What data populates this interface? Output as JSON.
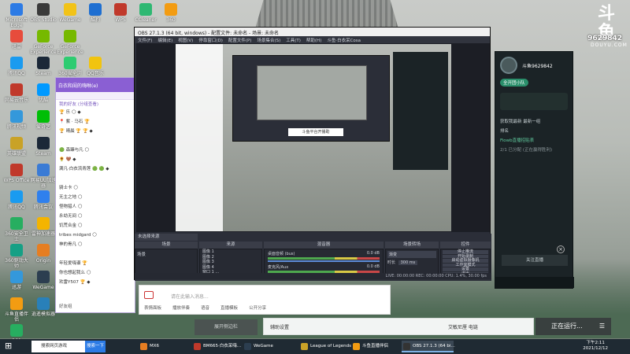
{
  "desktop": {
    "icons": [
      "Microsoft Edge",
      "OBS Studio",
      "WeGame",
      "酷狗",
      "WPS",
      "CCleaner",
      "360",
      "迅雷",
      "GeForce Experience",
      "GeForce Experience",
      "腾讯QQ",
      "Steam",
      "360安全浏览器",
      "QQ音乐",
      "网易云音乐",
      "优酷",
      "腾讯视频",
      "爱奇艺",
      "英雄联盟",
      "Steam",
      "WPS Office",
      "网易UU加速器",
      "腾讯QQ",
      "腾讯会议",
      "360安全卫士",
      "雷神加速器",
      "360驱动大师",
      "Origin",
      "迅游",
      "WeGame",
      "斗鱼直播伴侣",
      "逍遥模拟器",
      "360"
    ]
  },
  "douyu": {
    "logo_text": "斗鱼",
    "logo_sub": "DOUYU.COM",
    "room_id": "9629842",
    "panel": {
      "username": "斗鱼9629842",
      "team_label": "全开团小队",
      "recent_label": "获取我最新 最新一组",
      "rank_label": "排名",
      "rank_sub": "2/1 已分配 (正在赢得胜利)",
      "promo": "Fiowb直播招贴表",
      "close_label": "关注直播"
    },
    "helper": {
      "assist": "辅助设置",
      "music": "艾敏尼厘 电链",
      "running": "正在运行...",
      "sidebar_btn": "展开侧边栏"
    }
  },
  "chat": {
    "title": "白衣和闺的嗨咻(e)",
    "list_header": "我的好友 (分组查看)",
    "items": [
      "🏆 乐 🌕 ◆",
      "📍 紫 · 马石 🏆",
      "🏆 晴晨 🏆 🏆 ◆",
      "",
      "🟢 森臻与凡 🌕",
      "🌻 🤎 ◆",
      "满凡·白衣流青莲 🟢 🟢 ◆",
      "",
      "骑士卡 🌕",
      "无主之地 🌕",
      "怪物猎人 🌕",
      "永劫无间 🌕",
      "饥荒合金 🌕",
      "tribes midgard 🌕",
      "神的骨凡 🌕",
      "",
      "年轻爱嗨谱 🏆",
      "你也想起我么 🌕",
      "欢雷Y507 🏆 ◆"
    ],
    "footer": "好友组",
    "input_placeholder": "请在此输入消息...",
    "input_actions": [
      "表情面板",
      "播放伴奏",
      "语音",
      "直播模板",
      "公开分享"
    ]
  },
  "obs": {
    "title": "OBS 27.1.3 (64 bit, windows) - 配置文件: 未命名 - 场景: 未命名",
    "menu": [
      "文件(F)",
      "编辑(E)",
      "视图(V)",
      "停靠窗口(D)",
      "配置文件(P)",
      "场景集合(S)",
      "工具(T)",
      "帮助(H)",
      "斗鱼·白衣呆Cosa"
    ],
    "nested_caption": "斗鱼平台开播助",
    "docks": {
      "scene_label": "未选择来源",
      "scenes_header": "场景",
      "scene_item": "场景",
      "sources_header": "来源",
      "sources": [
        "图像 1",
        "图像 2",
        "图像 3",
        "图像 4",
        "窗口 1 ..."
      ],
      "mixer_header": "混音器",
      "mixer": [
        {
          "name": "桌面音频 (bus)",
          "db": "0.0 dB"
        },
        {
          "name": "麦克风/Aux",
          "db": "0.0 dB"
        }
      ],
      "transition_header": "场景转场",
      "transition_type": "渐变",
      "duration_label": "时长",
      "duration": "300 ms",
      "controls_header": "控件",
      "controls": [
        "停止推流",
        "开始录制",
        "启动虚拟摄像机",
        "工作室模式",
        "设置",
        "退出"
      ]
    },
    "status": "LIVE: 00:00:00   REC: 00:00:00   CPU: 1.4%, 30.00 fps"
  },
  "taskbar": {
    "search_placeholder": "搜索网页游戏",
    "search_button": "搜索一下",
    "items": [
      "MX6",
      "BM665·白衣呆嗨…",
      "WeGame",
      "League of Legends",
      "斗鱼直播伴侣",
      "OBS 27.1.3 (64 bi…"
    ],
    "time": "下午2:11",
    "date": "2021/12/12"
  }
}
